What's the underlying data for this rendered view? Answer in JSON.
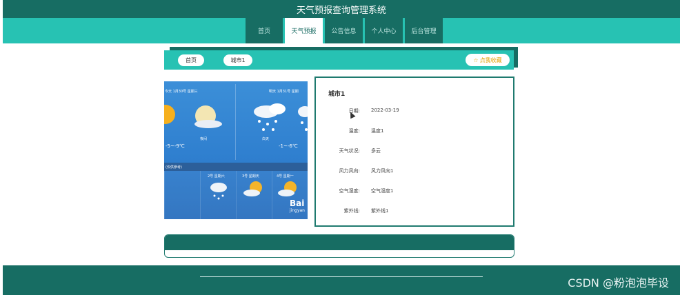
{
  "header": {
    "title": "天气预报查询管理系统"
  },
  "nav": {
    "items": [
      "首页",
      "天气预报",
      "公告信息",
      "个人中心",
      "后台管理"
    ],
    "active_index": 1
  },
  "breadcrumb": {
    "home": "首页",
    "current": "城市1",
    "favorite": "点我收藏"
  },
  "weather_image": {
    "today_label": "今天 1月30号 星期三",
    "tomorrow_label": "明天 1月31号 星期",
    "today_temp": "-5~-9℃",
    "tomorrow_temp": "-1~-6℃",
    "today_day": "夜间",
    "tomorrow_day": "白天",
    "band_label": "(仅供参考)",
    "day2": "2号 星期六",
    "day3": "3号 星期天",
    "day4": "4号 星期一",
    "brand": "Bai",
    "brand_sub": "jingyan"
  },
  "detail": {
    "title": "城市1",
    "rows": [
      {
        "label": "日期:",
        "value": "2022-03-19"
      },
      {
        "label": "温度:",
        "value": "温度1"
      },
      {
        "label": "天气状况:",
        "value": "多云"
      },
      {
        "label": "风力风向:",
        "value": "风力风向1"
      },
      {
        "label": "空气湿度:",
        "value": "空气湿度1"
      },
      {
        "label": "紫外线:",
        "value": "紫外线1"
      }
    ]
  },
  "watermark": "CSDN @粉泡泡毕设",
  "colors": {
    "dark_teal": "#176d63",
    "teal": "#27c2b3",
    "accent_gold": "#e0a000"
  }
}
